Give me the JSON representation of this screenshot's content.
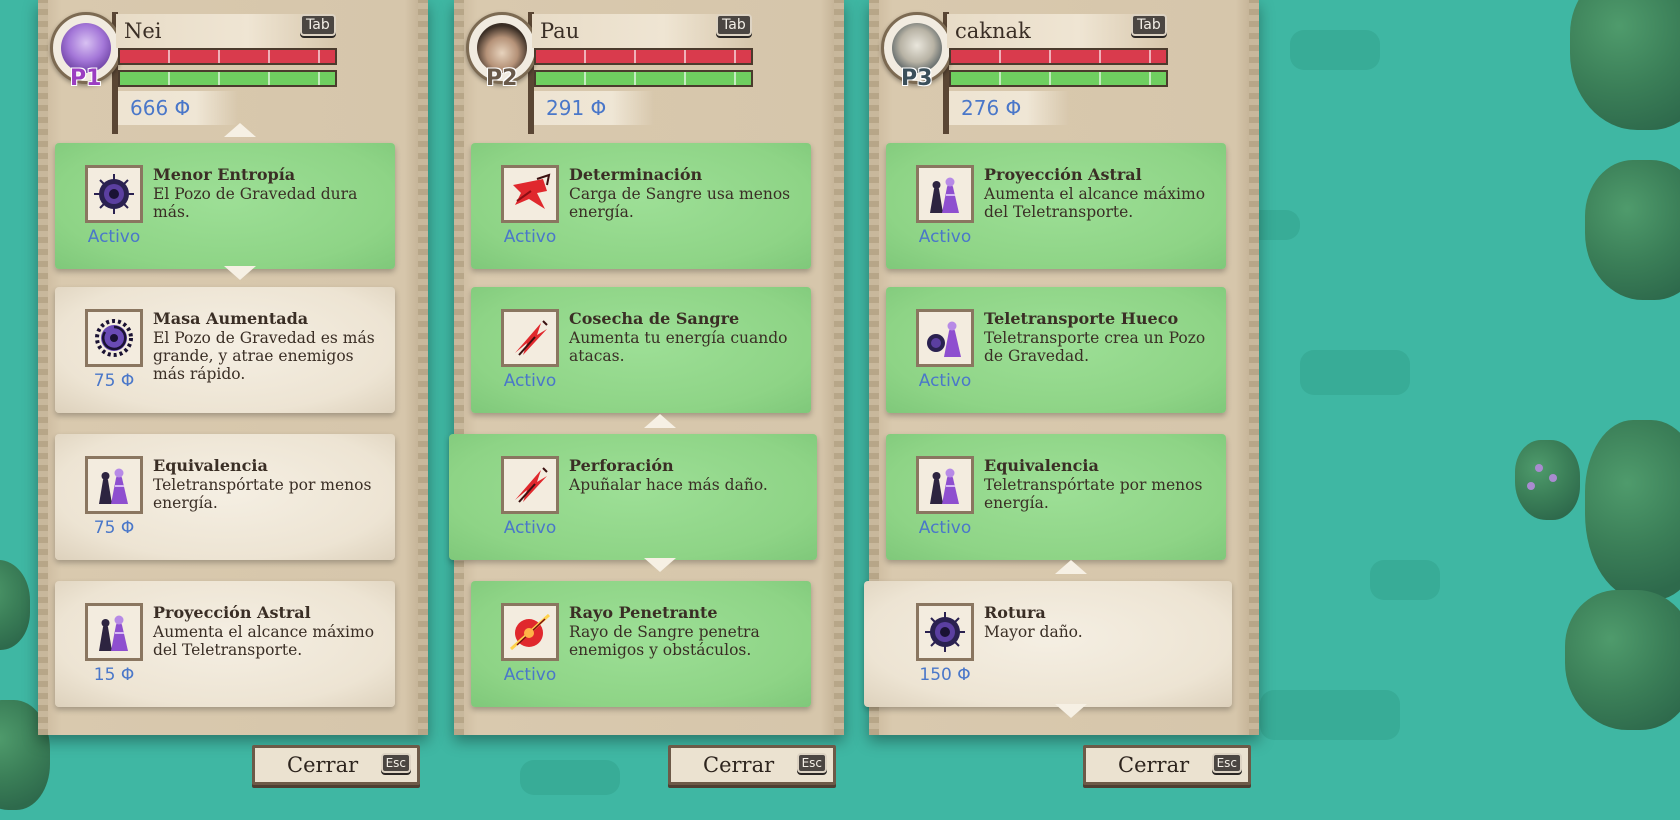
{
  "players": [
    {
      "name": "Nei",
      "label": "P1",
      "label_color": "#9b3ec1",
      "tab_key": "Tab",
      "currency": "666 Φ",
      "upgrades": [
        {
          "title": "Menor Entropía",
          "desc": "El Pozo de Gravedad dura más.",
          "status": "Activo",
          "state": "active",
          "icon": "gravity-well-icon"
        },
        {
          "title": "Masa Aumentada",
          "desc": "El Pozo de Gravedad es más grande, y atrae enemigos más rápido.",
          "status": "75 Φ",
          "state": "locked",
          "icon": "gravity-well-spiked-icon"
        },
        {
          "title": "Equivalencia",
          "desc": "Teletranspórtate por menos energía.",
          "status": "75 Φ",
          "state": "locked",
          "icon": "teleport-figures-icon"
        },
        {
          "title": "Proyección Astral",
          "desc": "Aumenta el alcance máximo del Teletransporte.",
          "status": "15 Φ",
          "state": "locked",
          "icon": "teleport-figures-icon"
        }
      ],
      "close_label": "Cerrar",
      "esc_key": "Esc"
    },
    {
      "name": "Pau",
      "label": "P2",
      "label_color": "#6a5a4a",
      "tab_key": "Tab",
      "currency": "291 Φ",
      "upgrades": [
        {
          "title": "Determinación",
          "desc": "Carga de Sangre usa menos energía.",
          "status": "Activo",
          "state": "active",
          "icon": "blood-charge-icon"
        },
        {
          "title": "Cosecha de Sangre",
          "desc": "Aumenta tu energía cuando atacas.",
          "status": "Activo",
          "state": "active",
          "icon": "blood-slash-icon"
        },
        {
          "title": "Perforación",
          "desc": "Apuñalar hace más daño.",
          "status": "Activo",
          "state": "active",
          "icon": "blood-slash-icon"
        },
        {
          "title": "Rayo Penetrante",
          "desc": "Rayo de Sangre penetra enemigos y obstáculos.",
          "status": "Activo",
          "state": "active",
          "icon": "blood-ray-icon"
        }
      ],
      "close_label": "Cerrar",
      "esc_key": "Esc"
    },
    {
      "name": "caknak",
      "label": "P3",
      "label_color": "#3b4f5a",
      "tab_key": "Tab",
      "currency": "276 Φ",
      "upgrades": [
        {
          "title": "Proyección Astral",
          "desc": "Aumenta el alcance máximo del Teletransporte.",
          "status": "Activo",
          "state": "active",
          "icon": "teleport-figures-icon"
        },
        {
          "title": "Teletransporte Hueco",
          "desc": "Teletransporte crea un Pozo de Gravedad.",
          "status": "Activo",
          "state": "active",
          "icon": "teleport-well-icon"
        },
        {
          "title": "Equivalencia",
          "desc": "Teletranspórtate por menos energía.",
          "status": "Activo",
          "state": "active",
          "icon": "teleport-figures-icon"
        },
        {
          "title": "Rotura",
          "desc": "Mayor daño.",
          "status": "150 Φ",
          "state": "locked",
          "icon": "gravity-well-icon"
        }
      ],
      "close_label": "Cerrar",
      "esc_key": "Esc"
    }
  ]
}
